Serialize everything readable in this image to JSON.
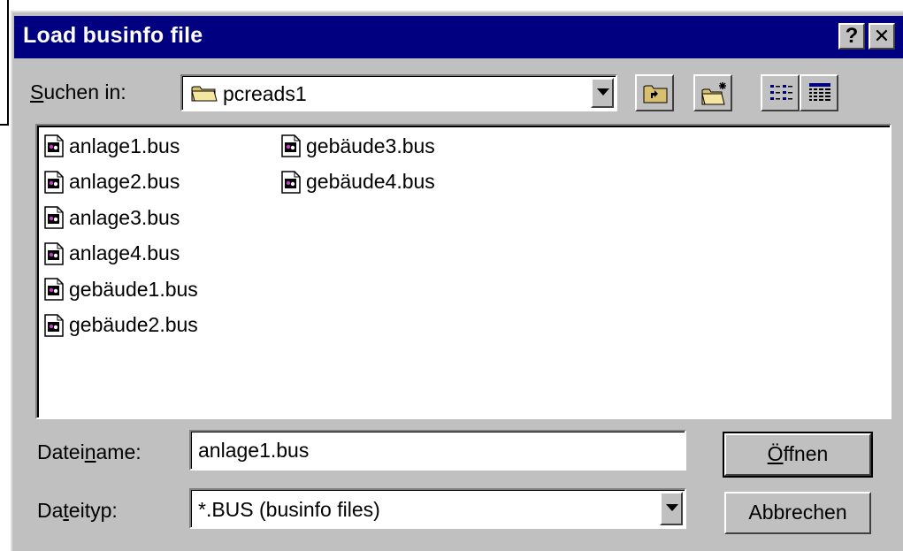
{
  "window": {
    "title": "Load businfo file",
    "help_label": "?",
    "close_label": "✕"
  },
  "look_in": {
    "label_prefix": "",
    "label_accel": "S",
    "label_rest": "uchen in:",
    "value": "pcreads1",
    "icon": "folder-icon"
  },
  "toolbar": {
    "buttons": [
      "up-one-level",
      "create-new-folder",
      "list-view",
      "details-view"
    ]
  },
  "files": [
    {
      "name": "anlage1.bus",
      "icon": "bus-file-icon"
    },
    {
      "name": "anlage2.bus",
      "icon": "bus-file-icon"
    },
    {
      "name": "anlage3.bus",
      "icon": "bus-file-icon"
    },
    {
      "name": "anlage4.bus",
      "icon": "bus-file-icon"
    },
    {
      "name": "gebäude1.bus",
      "icon": "bus-file-icon"
    },
    {
      "name": "gebäude2.bus",
      "icon": "bus-file-icon"
    },
    {
      "name": "gebäude3.bus",
      "icon": "bus-file-icon"
    },
    {
      "name": "gebäude4.bus",
      "icon": "bus-file-icon"
    }
  ],
  "filename": {
    "label_prefix": "Datei",
    "label_accel": "n",
    "label_rest": "ame:",
    "value": "anlage1.bus"
  },
  "filetype": {
    "label_prefix": "Da",
    "label_accel": "t",
    "label_rest": "eityp:",
    "value": "*.BUS (businfo files)"
  },
  "buttons": {
    "open_accel": "Ö",
    "open_rest": "ffnen",
    "cancel": "Abbrechen"
  },
  "colors": {
    "titlebar": "#000080",
    "face": "#c0c0c0"
  }
}
